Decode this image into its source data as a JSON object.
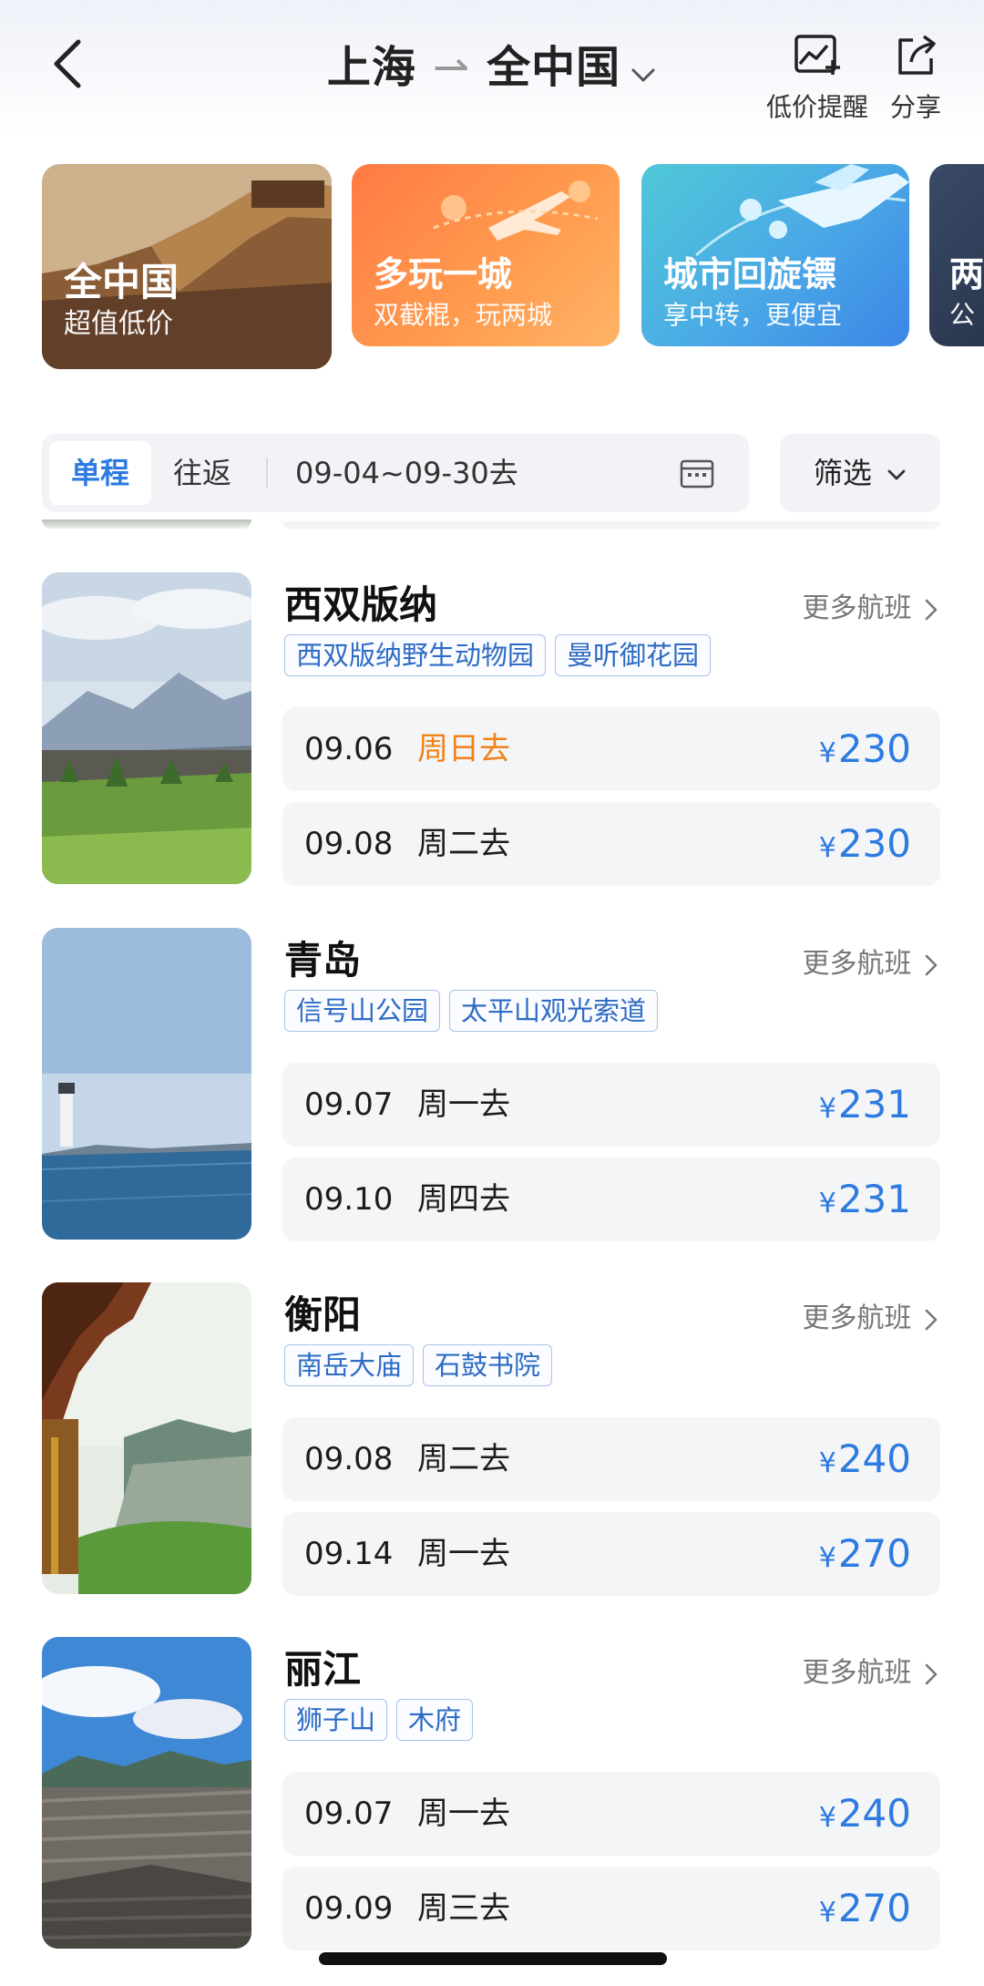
{
  "header": {
    "origin": "上海",
    "destination": "全中国",
    "price_alert_label": "低价提醒",
    "share_label": "分享"
  },
  "banners": [
    {
      "title": "全中国",
      "subtitle": "超值低价"
    },
    {
      "title": "多玩一城",
      "subtitle": "双截棍，玩两城"
    },
    {
      "title": "城市回旋镖",
      "subtitle": "享中转，更便宜"
    },
    {
      "title": "两",
      "subtitle": "公"
    }
  ],
  "filters": {
    "one_way": "单程",
    "round_trip": "往返",
    "date_range": "09-04~09-30去",
    "filter_label": "筛选"
  },
  "more_flights_label": "更多航班",
  "destinations": [
    {
      "name": "西双版纳",
      "tags": [
        "西双版纳野生动物园",
        "曼听御花园"
      ],
      "flights": [
        {
          "date": "09.06",
          "weekday": "周日去",
          "currency": "¥",
          "price": "230",
          "highlight": true
        },
        {
          "date": "09.08",
          "weekday": "周二去",
          "currency": "¥",
          "price": "230",
          "highlight": false
        }
      ]
    },
    {
      "name": "青岛",
      "tags": [
        "信号山公园",
        "太平山观光索道"
      ],
      "flights": [
        {
          "date": "09.07",
          "weekday": "周一去",
          "currency": "¥",
          "price": "231",
          "highlight": false
        },
        {
          "date": "09.10",
          "weekday": "周四去",
          "currency": "¥",
          "price": "231",
          "highlight": false
        }
      ]
    },
    {
      "name": "衡阳",
      "tags": [
        "南岳大庙",
        "石鼓书院"
      ],
      "flights": [
        {
          "date": "09.08",
          "weekday": "周二去",
          "currency": "¥",
          "price": "240",
          "highlight": false
        },
        {
          "date": "09.14",
          "weekday": "周一去",
          "currency": "¥",
          "price": "270",
          "highlight": false
        }
      ]
    },
    {
      "name": "丽江",
      "tags": [
        "狮子山",
        "木府"
      ],
      "flights": [
        {
          "date": "09.07",
          "weekday": "周一去",
          "currency": "¥",
          "price": "240",
          "highlight": false
        },
        {
          "date": "09.09",
          "weekday": "周三去",
          "currency": "¥",
          "price": "270",
          "highlight": false
        }
      ]
    }
  ],
  "colors": {
    "accent_blue": "#2d7be0",
    "weekend_orange": "#f0821a",
    "tag_border": "#a8c3e8",
    "row_bg": "#f4f5f7"
  }
}
